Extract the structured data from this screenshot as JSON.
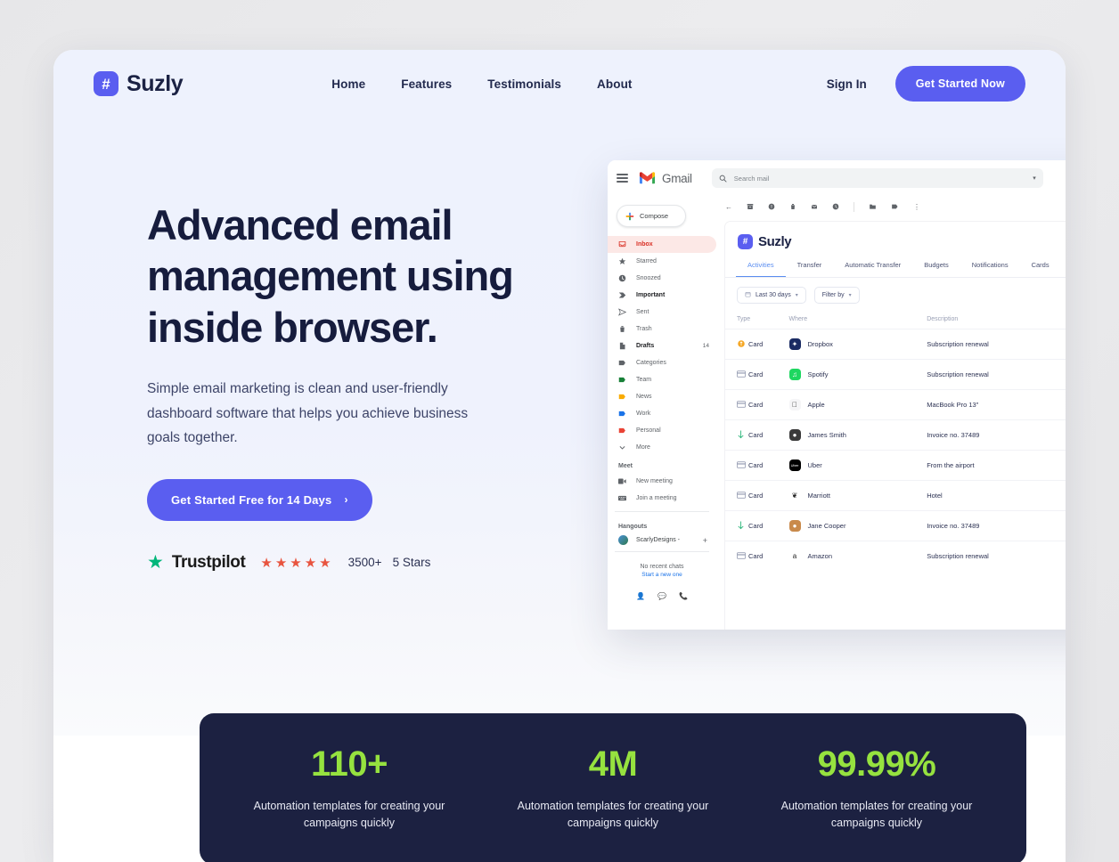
{
  "brand": {
    "name": "Suzly",
    "mark": "#",
    "accent": "#5a5ef0"
  },
  "nav": {
    "links": [
      {
        "label": "Home"
      },
      {
        "label": "Features"
      },
      {
        "label": "Testimonials"
      },
      {
        "label": "About"
      }
    ],
    "signin_label": "Sign In",
    "cta_label": "Get Started Now"
  },
  "hero": {
    "title_line1": "Advanced email",
    "title_line2": "management using",
    "title_line3": "inside browser.",
    "subtitle": "Simple email marketing is clean and user-friendly dashboard software that helps you achieve business goals together.",
    "cta_label": "Get Started Free for 14 Days",
    "cta_chevron": "›"
  },
  "trustpilot": {
    "star_glyph": "★",
    "name": "Trustpilot",
    "rating_stars": "★★★★★",
    "count": "3500+",
    "label": "5 Stars",
    "brand_color": "#00b67a",
    "star_color": "#e8543f"
  },
  "mockup": {
    "gmail": {
      "wordmark": "Gmail",
      "search_placeholder": "Search mail",
      "compose_label": "Compose",
      "toolbar_icons": [
        "back-arrow-icon",
        "archive-icon",
        "report-spam-icon",
        "delete-icon",
        "mark-unread-icon",
        "snooze-icon",
        "move-to-icon",
        "labels-icon",
        "more-options-icon"
      ],
      "sidebar": [
        {
          "label": "Inbox",
          "icon": "inbox-icon",
          "active": true,
          "color": "#d93025",
          "count": ""
        },
        {
          "label": "Starred",
          "icon": "star-icon",
          "color": "#5f6368",
          "count": ""
        },
        {
          "label": "Snoozed",
          "icon": "clock-icon",
          "color": "#5f6368",
          "count": ""
        },
        {
          "label": "Important",
          "icon": "important-icon",
          "color": "#5f6368",
          "bold": true,
          "count": ""
        },
        {
          "label": "Sent",
          "icon": "send-icon",
          "color": "#5f6368",
          "count": ""
        },
        {
          "label": "Trash",
          "icon": "trash-icon",
          "color": "#5f6368",
          "count": ""
        },
        {
          "label": "Drafts",
          "icon": "draft-icon",
          "color": "#5f6368",
          "bold": true,
          "count": "14"
        },
        {
          "label": "Categories",
          "icon": "label-icon",
          "color": "#5f6368",
          "count": ""
        },
        {
          "label": "Team",
          "icon": "label-icon",
          "color": "#188038",
          "count": ""
        },
        {
          "label": "News",
          "icon": "label-icon",
          "color": "#f9ab00",
          "count": ""
        },
        {
          "label": "Work",
          "icon": "label-icon",
          "color": "#1a73e8",
          "count": ""
        },
        {
          "label": "Personal",
          "icon": "label-icon",
          "color": "#ea4335",
          "count": ""
        },
        {
          "label": "More",
          "icon": "chevron-down-icon",
          "color": "#5f6368",
          "count": ""
        }
      ],
      "meet": {
        "title": "Meet",
        "items": [
          {
            "label": "New meeting",
            "icon": "video-camera-icon"
          },
          {
            "label": "Join a meeting",
            "icon": "keyboard-icon"
          }
        ]
      },
      "hangouts": {
        "title": "Hangouts",
        "account": "ScarlyDesigns -",
        "add_glyph": "+",
        "no_chats": "No recent chats",
        "start_new": "Start a new one",
        "footer_icons": [
          "person-icon",
          "chat-icon",
          "phone-icon"
        ]
      }
    },
    "app": {
      "brand_name": "Suzly",
      "brand_mark": "#",
      "tabs": [
        {
          "label": "Activities",
          "active": true
        },
        {
          "label": "Transfer",
          "active": false
        },
        {
          "label": "Automatic Transfer",
          "active": false
        },
        {
          "label": "Budgets",
          "active": false
        },
        {
          "label": "Notifications",
          "active": false
        },
        {
          "label": "Cards",
          "active": false
        }
      ],
      "filters": [
        {
          "label": "Last 30 days",
          "icon": "calendar-icon",
          "caret": "▾"
        },
        {
          "label": "Filter by",
          "icon": "",
          "caret": "▾"
        }
      ],
      "table": {
        "columns": [
          "Type",
          "",
          "Where",
          "Description",
          ""
        ],
        "rows": [
          {
            "type_icon": "coin-icon",
            "type": "Card",
            "logo": "Dropbox",
            "logo_glyph": "✦",
            "logo_bg": "#1a2b63",
            "where": "Dropbox",
            "description": "Subscription renewal",
            "amount": "-",
            "amount_sign": "neg"
          },
          {
            "type_icon": "card-icon",
            "type": "Card",
            "logo": "Spotify",
            "logo_glyph": "♫",
            "logo_bg": "#1ed760",
            "where": "Spotify",
            "description": "Subscription renewal",
            "amount": "",
            "amount_sign": ""
          },
          {
            "type_icon": "card-icon",
            "type": "Card",
            "logo": "Apple",
            "logo_glyph": "",
            "logo_bg": "#f5f5f7",
            "where": "Apple",
            "description": "MacBook Pro 13\"",
            "amount": "- $",
            "amount_sign": "neg"
          },
          {
            "type_icon": "down-arrow-icon",
            "type": "Card",
            "logo": "James Smith",
            "logo_glyph": "●",
            "logo_bg": "#3a3a3a",
            "where": "James Smith",
            "description": "Invoice no. 37489",
            "amount": "",
            "amount_sign": "pos"
          },
          {
            "type_icon": "card-icon",
            "type": "Card",
            "logo": "Uber",
            "logo_glyph": "Uber",
            "logo_bg": "#000000",
            "where": "Uber",
            "description": "From the airport",
            "amount": "",
            "amount_sign": ""
          },
          {
            "type_icon": "card-icon",
            "type": "Card",
            "logo": "Marriott",
            "logo_glyph": "❦",
            "logo_bg": "#ffffff",
            "where": "Marriott",
            "description": "Hotel",
            "amount": "-",
            "amount_sign": "neg"
          },
          {
            "type_icon": "down-arrow-icon",
            "type": "Card",
            "logo": "Jane Cooper",
            "logo_glyph": "●",
            "logo_bg": "#c98a4b",
            "where": "Jane Cooper",
            "description": "Invoice no. 37489",
            "amount": "+",
            "amount_sign": "pos"
          },
          {
            "type_icon": "card-icon",
            "type": "Card",
            "logo": "Amazon",
            "logo_glyph": "a",
            "logo_bg": "#ffffff",
            "where": "Amazon",
            "description": "Subscription renewal",
            "amount": "",
            "amount_sign": ""
          }
        ]
      }
    }
  },
  "stats": {
    "accent": "#96e23f",
    "background": "#1c2141",
    "items": [
      {
        "value": "110+",
        "description": "Automation templates for creating your campaigns quickly"
      },
      {
        "value": "4M",
        "description": "Automation templates for creating your campaigns quickly"
      },
      {
        "value": "99.99%",
        "description": "Automation templates for creating your campaigns quickly"
      }
    ]
  }
}
